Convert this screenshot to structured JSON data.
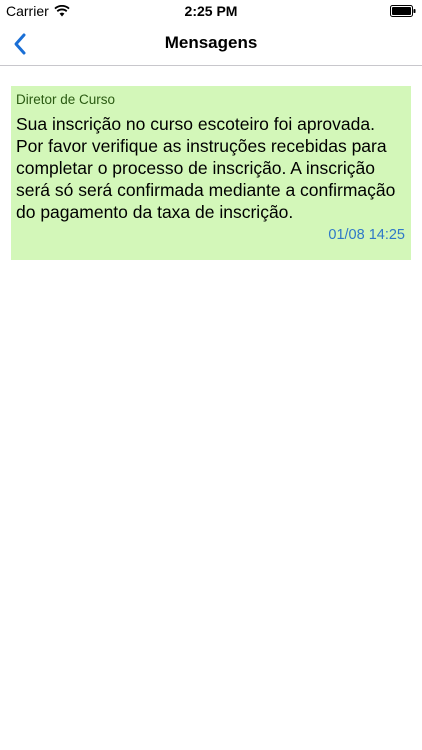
{
  "status_bar": {
    "carrier": "Carrier",
    "time": "2:25 PM",
    "wifi_icon": "wifi-icon",
    "battery_icon": "battery-icon"
  },
  "nav": {
    "back_icon": "chevron-left-icon",
    "title": "Mensagens",
    "accent_color": "#1a6fd6"
  },
  "messages": [
    {
      "sender": "Diretor de Curso",
      "text": "Sua inscrição no curso escoteiro foi aprovada. Por favor verifique as instruções recebidas para completar o processo de inscrição. A inscrição será só será confirmada mediante a confirmação do pagamento da taxa de inscrição.",
      "timestamp": "01/08 14:25",
      "background_color": "#d3f7b9"
    }
  ]
}
